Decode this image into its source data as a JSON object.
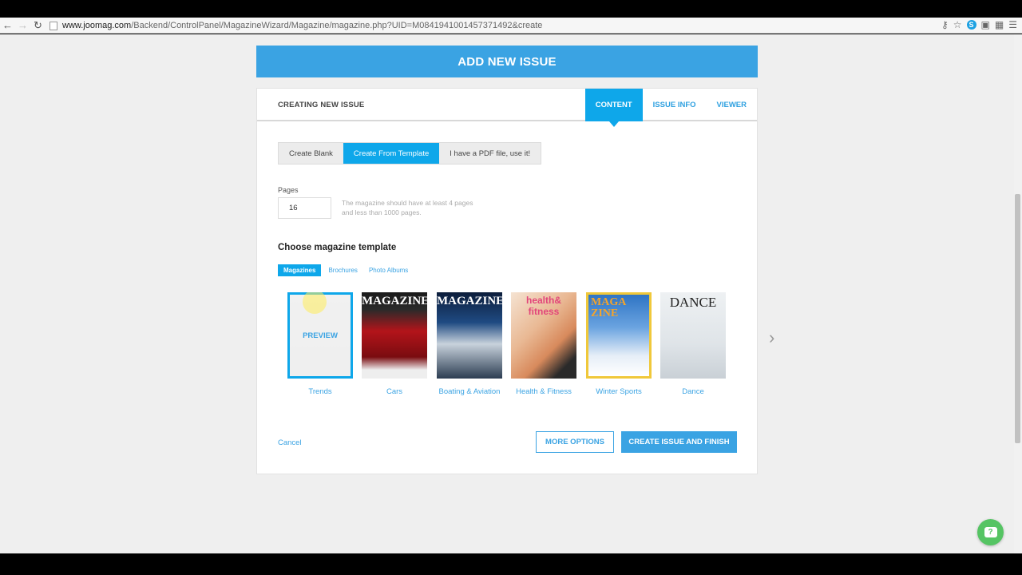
{
  "browser": {
    "url_host": "www.joomag.com",
    "url_path": "/Backend/ControlPanel/MagazineWizard/Magazine/magazine.php?UID=M0841941001457371492&create",
    "back_icon": "back-arrow-icon",
    "forward_icon": "forward-arrow-icon",
    "reload_icon": "reload-icon"
  },
  "banner": {
    "title": "ADD NEW ISSUE"
  },
  "panel": {
    "title": "CREATING NEW ISSUE",
    "tabs": [
      {
        "label": "CONTENT",
        "active": true
      },
      {
        "label": "ISSUE INFO",
        "active": false
      },
      {
        "label": "VIEWER",
        "active": false
      }
    ]
  },
  "mode": {
    "options": [
      {
        "label": "Create Blank",
        "active": false
      },
      {
        "label": "Create From Template",
        "active": true
      },
      {
        "label": "I have a PDF file, use it!",
        "active": false
      }
    ]
  },
  "pages": {
    "label": "Pages",
    "value": "16",
    "hint": "The magazine should have at least 4 pages and less than 1000 pages."
  },
  "templates": {
    "title": "Choose magazine template",
    "categories": [
      {
        "label": "Magazines",
        "active": true
      },
      {
        "label": "Brochures",
        "active": false
      },
      {
        "label": "Photo Albums",
        "active": false
      }
    ],
    "preview_label": "PREVIEW",
    "items": [
      {
        "name": "Trends",
        "cover_text": "",
        "selected": true
      },
      {
        "name": "Cars",
        "cover_text": "MAGAZINE",
        "selected": false
      },
      {
        "name": "Boating & Aviation",
        "cover_text": "MAGAZINE",
        "selected": false
      },
      {
        "name": "Health & Fitness",
        "cover_text": "health& fitness",
        "selected": false
      },
      {
        "name": "Winter Sports",
        "cover_text": "MAGA ZINE",
        "selected": false
      },
      {
        "name": "Dance",
        "cover_text": "DANCE",
        "selected": false
      }
    ]
  },
  "actions": {
    "cancel": "Cancel",
    "more_options": "MORE OPTIONS",
    "create_finish": "CREATE ISSUE AND FINISH"
  },
  "colors": {
    "accent": "#3aa3e3",
    "active_tab": "#0ea7ea",
    "chat": "#55c463"
  }
}
